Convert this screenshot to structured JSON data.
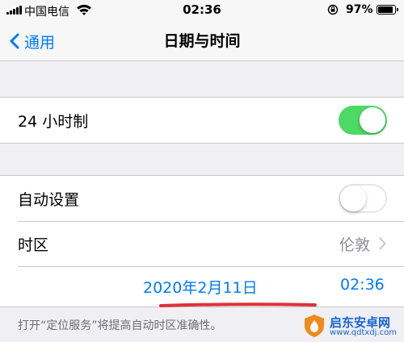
{
  "status_bar": {
    "carrier": "中国电信",
    "time": "02:36",
    "battery_percent": "97%",
    "battery_level": 0.97
  },
  "nav": {
    "back_label": "通用",
    "title": "日期与时间"
  },
  "settings": {
    "hour24": {
      "label": "24 小时制",
      "on": true
    },
    "auto_set": {
      "label": "自动设置",
      "on": false
    },
    "timezone": {
      "label": "时区",
      "value": "伦敦"
    },
    "date": "2020年2月11日",
    "time": "02:36"
  },
  "footer_note": "打开“定位服务”将提高自动时区准确性。",
  "colors": {
    "accent": "#007aff",
    "toggle_on": "#4cd964",
    "underline": "#e0303a"
  },
  "watermark": {
    "name": "启东安卓网",
    "url": "www.qdtxdj.com"
  }
}
